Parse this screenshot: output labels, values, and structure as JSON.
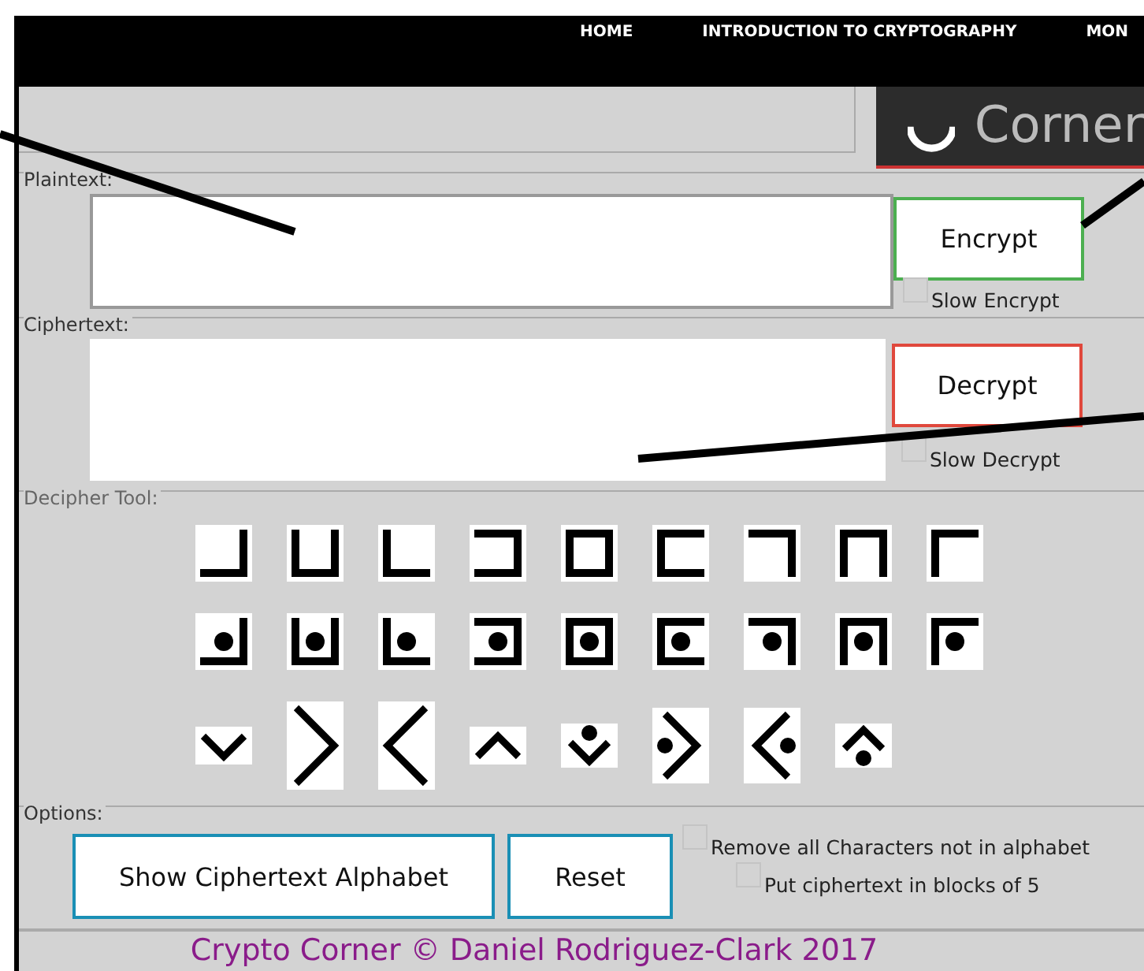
{
  "nav": {
    "items": [
      "HOME",
      "INTRODUCTION TO CRYPTOGRAPHY",
      "MON"
    ]
  },
  "logo": {
    "text": "Corner"
  },
  "plaintext": {
    "legend": "Plaintext:",
    "button": "Encrypt",
    "slow": {
      "label": "Slow Encrypt",
      "checked": false
    }
  },
  "ciphertext": {
    "legend": "Ciphertext:",
    "button": "Decrypt",
    "slow": {
      "label": "Slow Decrypt",
      "checked": false
    }
  },
  "decipher_tool": {
    "legend": "Decipher Tool:",
    "rows": [
      [
        {
          "kind": "grid",
          "top": false,
          "right": true,
          "bottom": true,
          "left": false,
          "dot": false
        },
        {
          "kind": "grid",
          "top": false,
          "right": true,
          "bottom": true,
          "left": true,
          "dot": false
        },
        {
          "kind": "grid",
          "top": false,
          "right": false,
          "bottom": true,
          "left": true,
          "dot": false
        },
        {
          "kind": "grid",
          "top": true,
          "right": true,
          "bottom": true,
          "left": false,
          "dot": false
        },
        {
          "kind": "grid",
          "top": true,
          "right": true,
          "bottom": true,
          "left": true,
          "dot": false
        },
        {
          "kind": "grid",
          "top": true,
          "right": false,
          "bottom": true,
          "left": true,
          "dot": false
        },
        {
          "kind": "grid",
          "top": true,
          "right": true,
          "bottom": false,
          "left": false,
          "dot": false
        },
        {
          "kind": "grid",
          "top": true,
          "right": true,
          "bottom": false,
          "left": true,
          "dot": false
        },
        {
          "kind": "grid",
          "top": true,
          "right": false,
          "bottom": false,
          "left": true,
          "dot": false
        }
      ],
      [
        {
          "kind": "grid",
          "top": false,
          "right": true,
          "bottom": true,
          "left": false,
          "dot": true
        },
        {
          "kind": "grid",
          "top": false,
          "right": true,
          "bottom": true,
          "left": true,
          "dot": true
        },
        {
          "kind": "grid",
          "top": false,
          "right": false,
          "bottom": true,
          "left": true,
          "dot": true
        },
        {
          "kind": "grid",
          "top": true,
          "right": true,
          "bottom": true,
          "left": false,
          "dot": true
        },
        {
          "kind": "grid",
          "top": true,
          "right": true,
          "bottom": true,
          "left": true,
          "dot": true
        },
        {
          "kind": "grid",
          "top": true,
          "right": false,
          "bottom": true,
          "left": true,
          "dot": true
        },
        {
          "kind": "grid",
          "top": true,
          "right": true,
          "bottom": false,
          "left": false,
          "dot": true
        },
        {
          "kind": "grid",
          "top": true,
          "right": true,
          "bottom": false,
          "left": true,
          "dot": true
        },
        {
          "kind": "grid",
          "top": true,
          "right": false,
          "bottom": false,
          "left": true,
          "dot": true
        }
      ],
      [
        {
          "kind": "down",
          "dot": false
        },
        {
          "kind": "right",
          "dot": false
        },
        {
          "kind": "left",
          "dot": false
        },
        {
          "kind": "up",
          "dot": false
        },
        {
          "kind": "down",
          "dot": true
        },
        {
          "kind": "right",
          "dot": true
        },
        {
          "kind": "left",
          "dot": true
        },
        {
          "kind": "up",
          "dot": true
        }
      ]
    ]
  },
  "options": {
    "legend": "Options:",
    "buttons": [
      "Show Ciphertext Alphabet",
      "Reset"
    ],
    "checks": [
      {
        "label": "Remove all Characters not in alphabet",
        "checked": false
      },
      {
        "label": "Put ciphertext in blocks of 5",
        "checked": false
      }
    ]
  },
  "footer": "Crypto Corner © Daniel Rodriguez-Clark 2017"
}
